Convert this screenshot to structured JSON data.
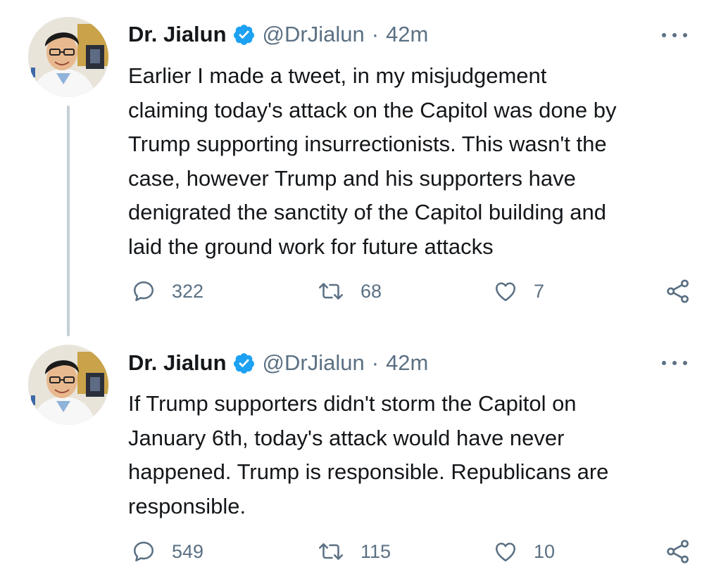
{
  "tweets": [
    {
      "author": {
        "name": "Dr. Jialun",
        "handle": "@DrJialun",
        "separator": "·",
        "time": "42m",
        "verified": true
      },
      "text": "Earlier I made a tweet, in my misjudgement\nclaiming today's attack on the Capitol was done by\nTrump supporting insurrectionists. This wasn't the\ncase, however Trump and his supporters have\ndenigrated the sanctity of the Capitol building and\nlaid the ground work for future attacks",
      "stats": {
        "replies": "322",
        "retweets": "68",
        "likes": "7"
      }
    },
    {
      "author": {
        "name": "Dr. Jialun",
        "handle": "@DrJialun",
        "separator": "·",
        "time": "42m",
        "verified": true
      },
      "text": "If Trump supporters didn't storm the Capitol on\nJanuary 6th, today's attack would have never\nhappened. Trump is responsible. Republicans are\nresponsible.",
      "stats": {
        "replies": "549",
        "retweets": "115",
        "likes": "10"
      }
    }
  ],
  "icons": {
    "verified": "verified-badge-icon",
    "more": "more-options-icon",
    "reply": "reply-icon",
    "retweet": "retweet-icon",
    "like": "heart-icon",
    "share": "share-icon"
  },
  "colors": {
    "verified_blue": "#1da1f2",
    "text_primary": "#14171a",
    "text_secondary": "#5b7083",
    "thread_line": "#c4cfd6"
  }
}
